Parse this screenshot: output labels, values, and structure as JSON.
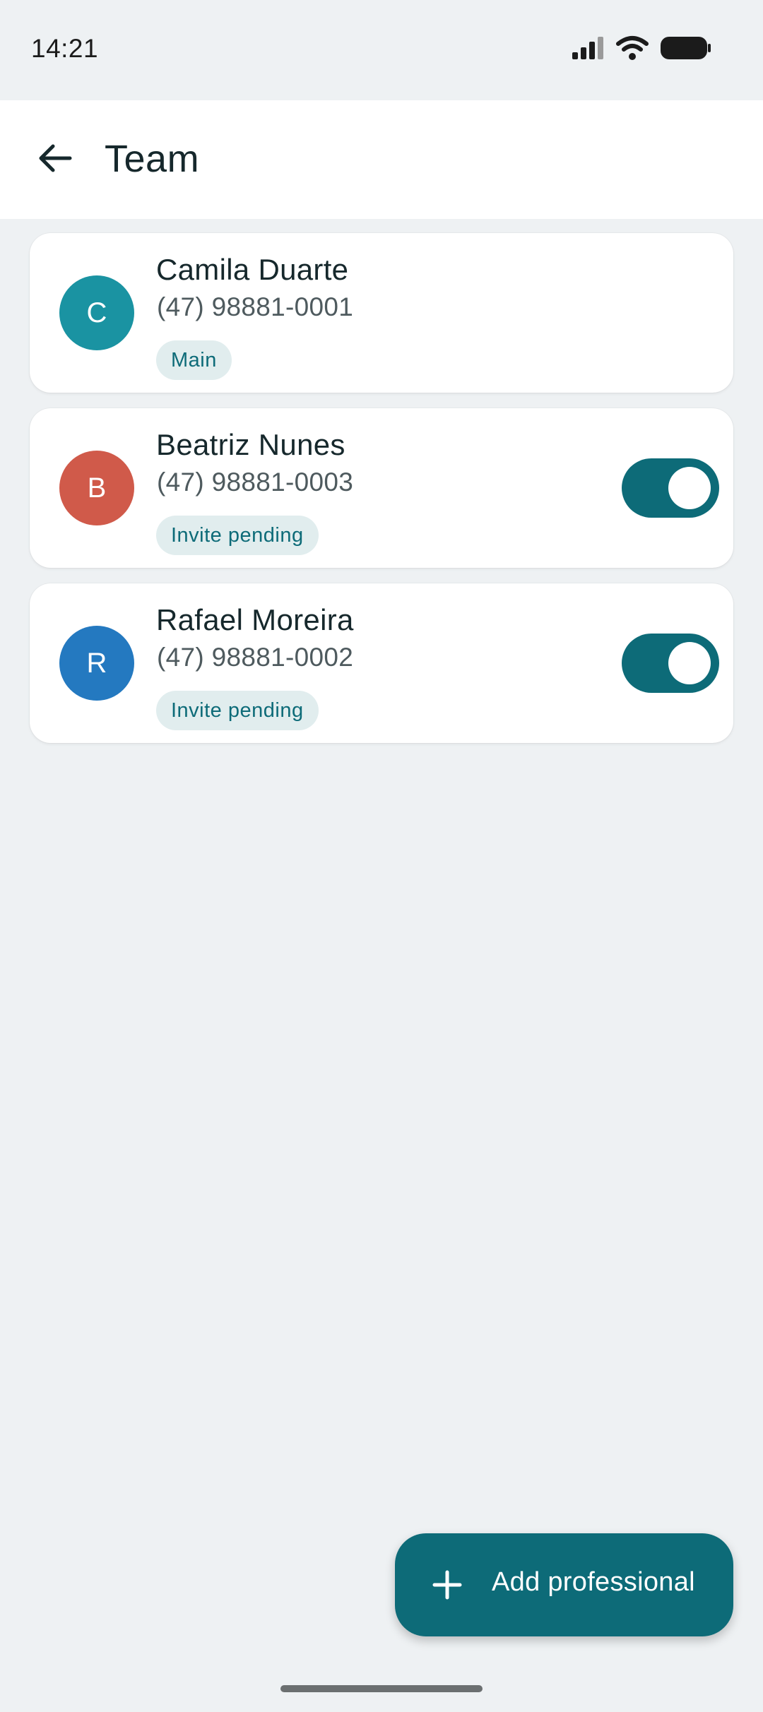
{
  "status_bar": {
    "time": "14:21"
  },
  "header": {
    "title": "Team"
  },
  "members": [
    {
      "initial": "C",
      "name": "Camila Duarte",
      "phone": "(47) 98881-0001",
      "badge": "Main",
      "avatar_color": "#1a93a2",
      "has_toggle": false
    },
    {
      "initial": "B",
      "name": "Beatriz Nunes",
      "phone": "(47) 98881-0003",
      "badge": "Invite pending",
      "avatar_color": "#d05a4a",
      "has_toggle": true,
      "toggle_on": true
    },
    {
      "initial": "R",
      "name": "Rafael Moreira",
      "phone": "(47) 98881-0002",
      "badge": "Invite pending",
      "avatar_color": "#2479c0",
      "has_toggle": true,
      "toggle_on": true
    }
  ],
  "fab": {
    "label": "Add professional"
  },
  "colors": {
    "accent": "#0d6b78",
    "background": "#eef1f3",
    "badge_bg": "#e1edee"
  }
}
